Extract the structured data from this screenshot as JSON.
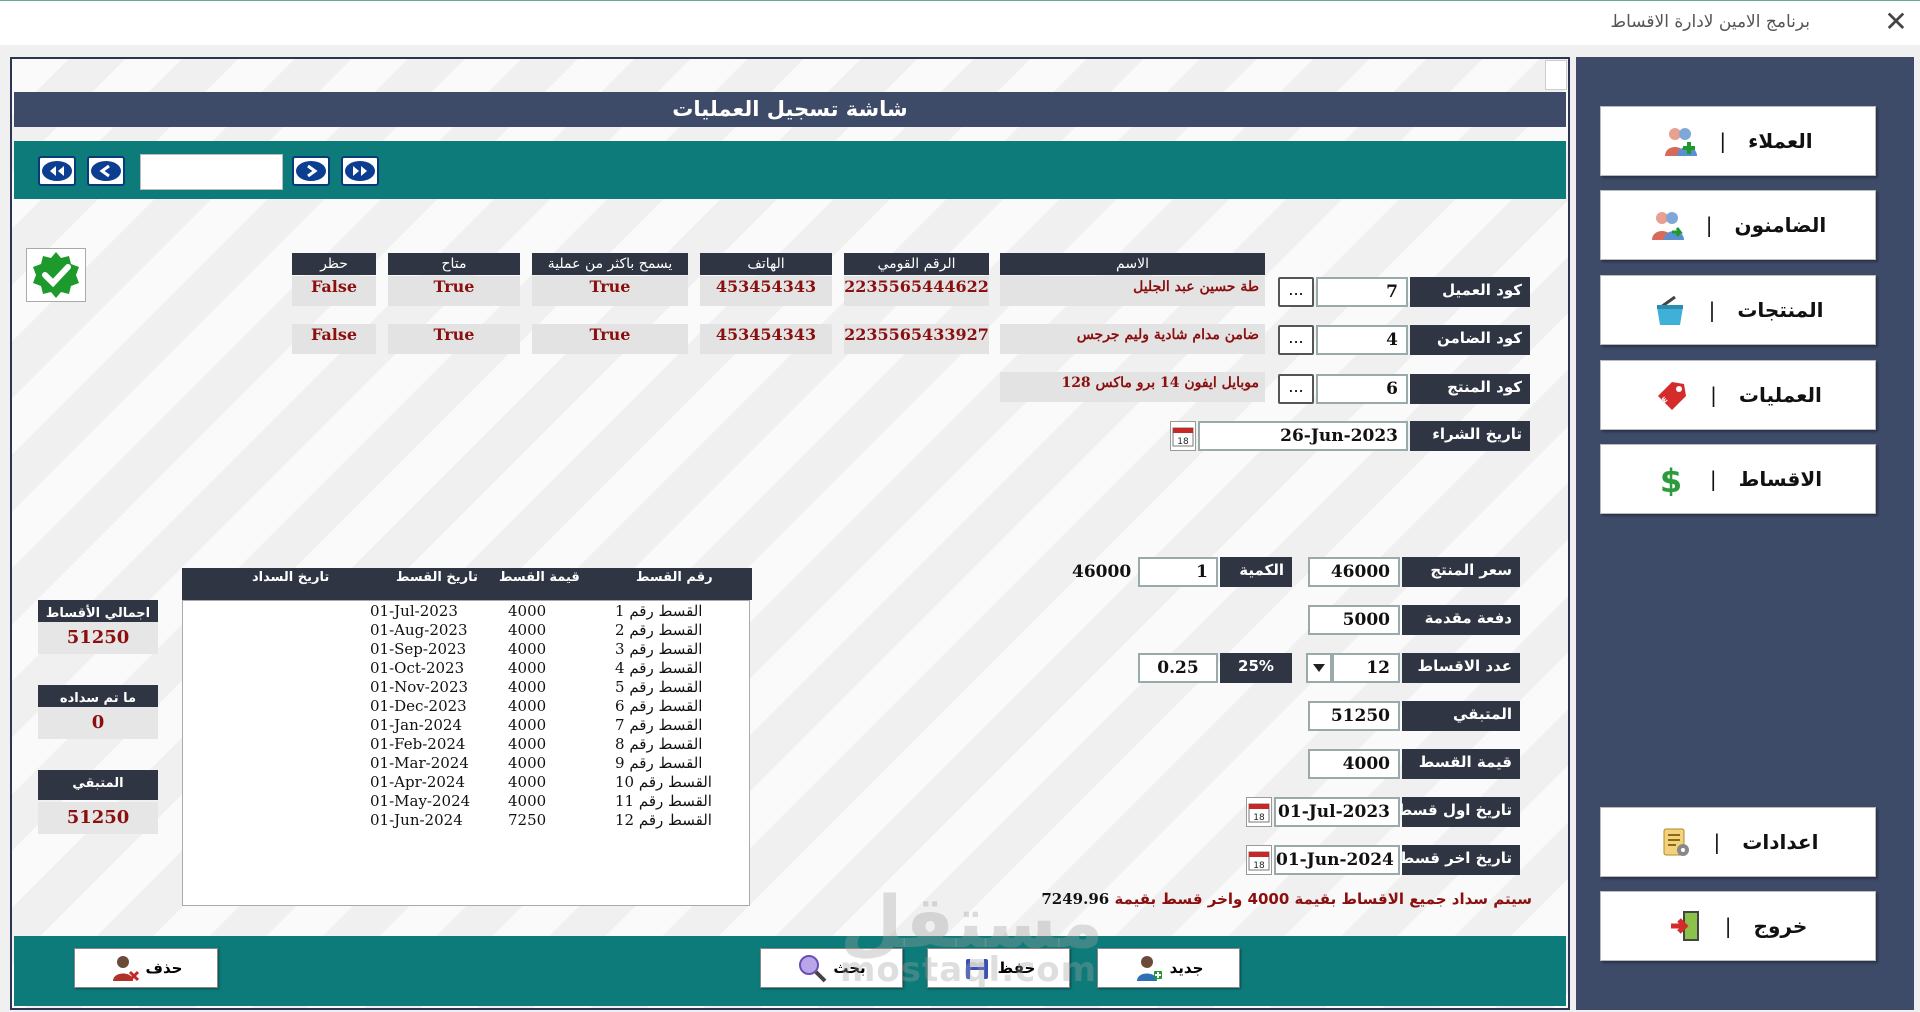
{
  "window": {
    "title": "برنامج الامين لادارة الاقساط",
    "close": "✕"
  },
  "header": {
    "title": "شاشة تسجيل العمليات"
  },
  "sidebar": {
    "items": [
      {
        "label": "العملاء",
        "sep": "|",
        "icon": "users-add-icon"
      },
      {
        "label": "الضامنون",
        "sep": "|",
        "icon": "guarantors-icon"
      },
      {
        "label": "المنتجات",
        "sep": "|",
        "icon": "products-basket-icon"
      },
      {
        "label": "العمليات",
        "sep": "|",
        "icon": "sale-tag-icon"
      },
      {
        "label": "الاقساط",
        "sep": "|",
        "icon": "dollar-icon"
      },
      {
        "label": "اعدادات",
        "sep": "|",
        "icon": "settings-icon"
      },
      {
        "label": "خروج",
        "sep": "|",
        "icon": "exit-door-icon"
      }
    ]
  },
  "info_table": {
    "headers": {
      "name": "الاسم",
      "national_id": "الرقم القومي",
      "phone": "الهاتف",
      "multi": "يسمح باكثر من عملية",
      "available": "متاح",
      "blocked": "حظر"
    },
    "customer": {
      "name": "طة حسين عبد الجليل",
      "national_id": "2235565444622",
      "phone": "453454343",
      "multi": "True",
      "available": "True",
      "blocked": "False"
    },
    "guarantor": {
      "name": "ضامن مدام شادية وليم جرجس",
      "national_id": "2235565433927",
      "phone": "453454343",
      "multi": "True",
      "available": "True",
      "blocked": "False"
    },
    "product": {
      "name": "موبايل ايفون 14 برو ماكس 128"
    }
  },
  "form": {
    "customer_code": {
      "label": "كود العميل",
      "value": "7",
      "button": "..."
    },
    "guarantor_code": {
      "label": "كود الضامن",
      "value": "4",
      "button": "..."
    },
    "product_code": {
      "label": "كود المنتج",
      "value": "6",
      "button": "..."
    },
    "purchase_date": {
      "label": "تاريخ الشراء",
      "value": "26-Jun-2023"
    },
    "product_price": {
      "label": "سعر المنتج",
      "value": "46000"
    },
    "quantity": {
      "label": "الكمية",
      "value": "1",
      "total": "46000"
    },
    "down_payment": {
      "label": "دفعة مقدمة",
      "value": "5000"
    },
    "installments_count": {
      "label": "عدد الاقساط",
      "value": "12",
      "percent_label": "25%",
      "percent_value": "0.25"
    },
    "remaining": {
      "label": "المتبقي",
      "value": "51250"
    },
    "installment_value": {
      "label": "قيمة القسط",
      "value": "4000"
    },
    "first_date": {
      "label": "تاريخ اول قسط",
      "value": "01-Jul-2023"
    },
    "last_date": {
      "label": "تاريخ اخر قسط",
      "value": "01-Jun-2024"
    },
    "calendar_day": "18"
  },
  "message": {
    "text": "سيتم سداد جميع الاقساط بقيمة 4000 واخر قسط بقيمة",
    "value": "7249.96"
  },
  "summary": {
    "total_label": "اجمالي الأقساط",
    "total_value": "51250",
    "paid_label": "ما تم سداده",
    "paid_value": "0",
    "remaining_label": "المتبقي",
    "remaining_value": "51250"
  },
  "schedule": {
    "headers": {
      "number": "رقم القسط",
      "value": "قيمة القسط",
      "date": "تاريخ القسط",
      "paid_date": "تاريخ السداد"
    },
    "rows": [
      {
        "number": "القسط رقم 1",
        "value": "4000",
        "date": "01-Jul-2023"
      },
      {
        "number": "القسط رقم 2",
        "value": "4000",
        "date": "01-Aug-2023"
      },
      {
        "number": "القسط رقم 3",
        "value": "4000",
        "date": "01-Sep-2023"
      },
      {
        "number": "القسط رقم 4",
        "value": "4000",
        "date": "01-Oct-2023"
      },
      {
        "number": "القسط رقم 5",
        "value": "4000",
        "date": "01-Nov-2023"
      },
      {
        "number": "القسط رقم 6",
        "value": "4000",
        "date": "01-Dec-2023"
      },
      {
        "number": "القسط رقم 7",
        "value": "4000",
        "date": "01-Jan-2024"
      },
      {
        "number": "القسط رقم 8",
        "value": "4000",
        "date": "01-Feb-2024"
      },
      {
        "number": "القسط رقم 9",
        "value": "4000",
        "date": "01-Mar-2024"
      },
      {
        "number": "القسط رقم 10",
        "value": "4000",
        "date": "01-Apr-2024"
      },
      {
        "number": "القسط رقم 11",
        "value": "4000",
        "date": "01-May-2024"
      },
      {
        "number": "القسط رقم 12",
        "value": "7250",
        "date": "01-Jun-2024"
      }
    ]
  },
  "actions": {
    "new": "جديد",
    "save": "حفظ",
    "search": "بحث",
    "delete": "حذف"
  },
  "watermark": {
    "text": "مستقل",
    "sub": "mostaql.com"
  },
  "colors": {
    "header": "#3d4a68",
    "teal": "#0d7b7a",
    "dark_label": "#2f3542",
    "value_red": "#8b0f0f"
  }
}
